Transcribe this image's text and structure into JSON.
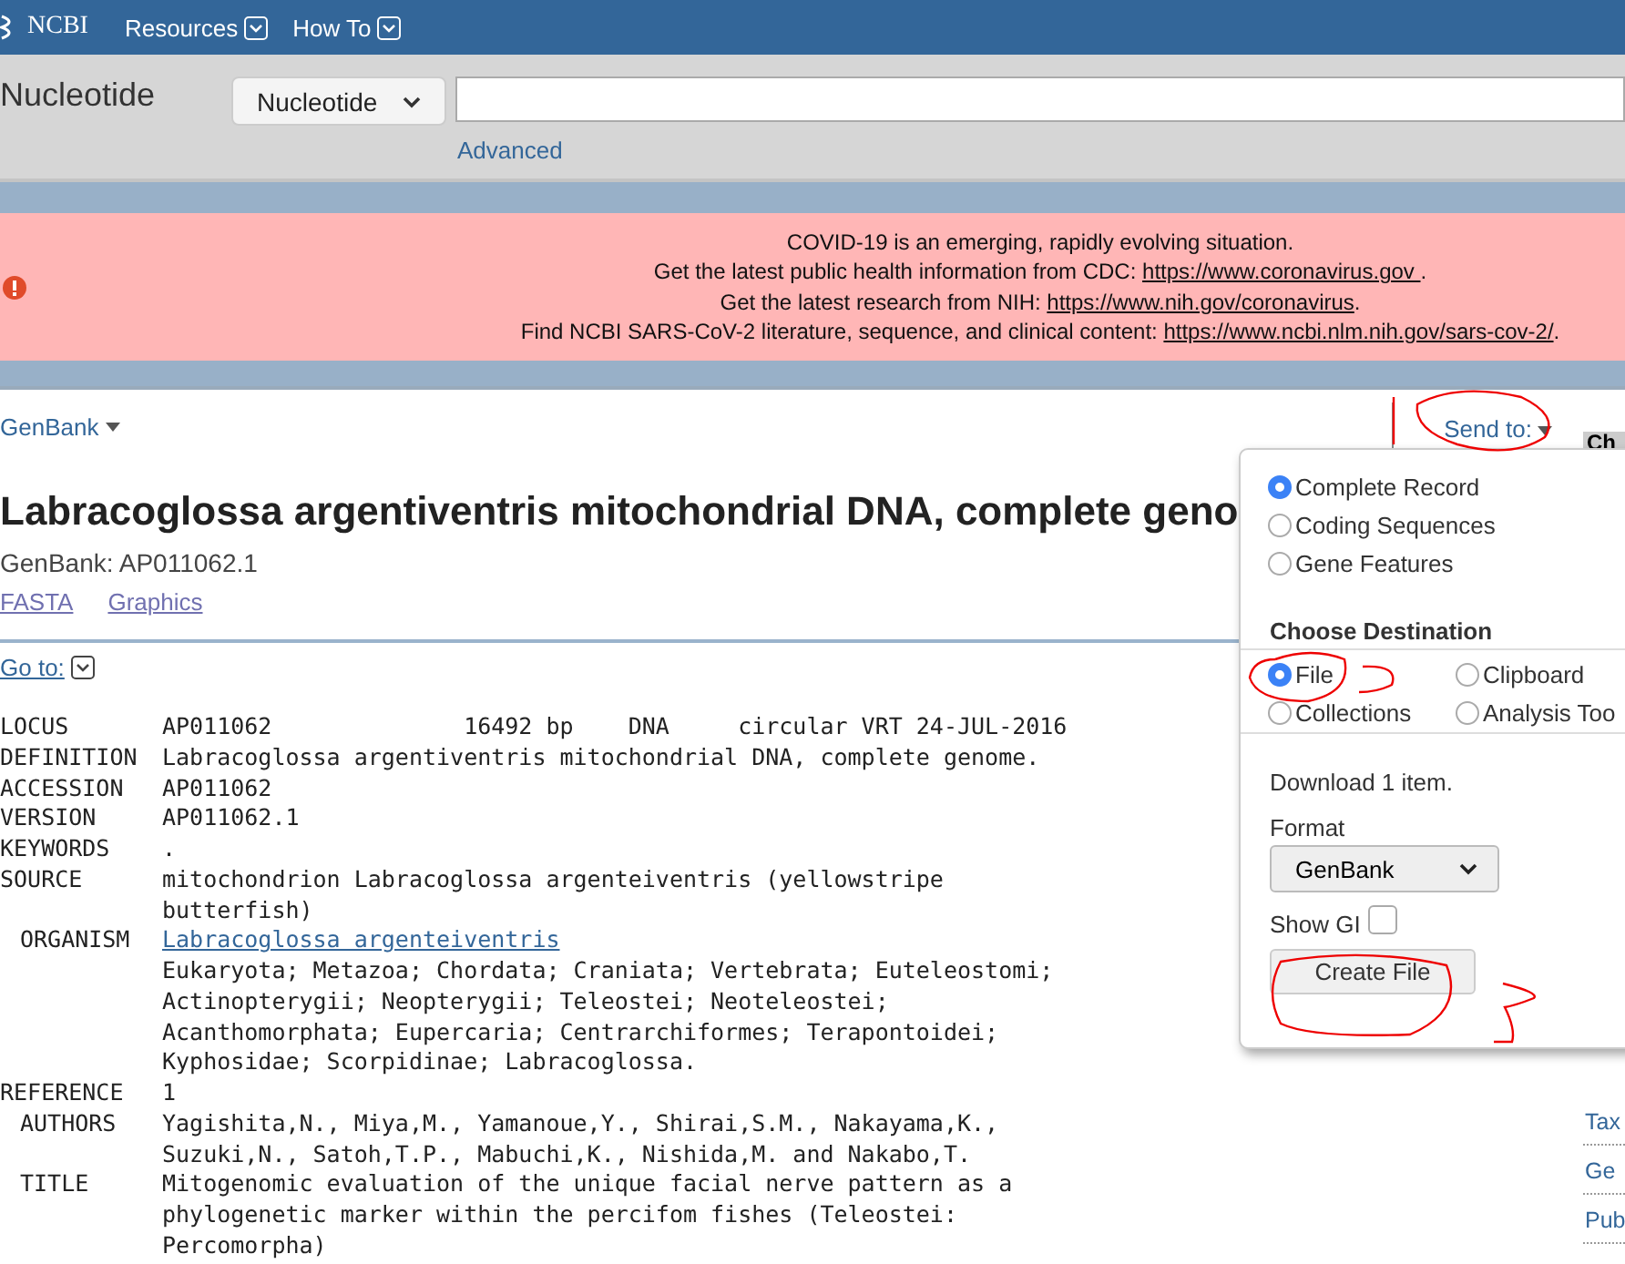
{
  "header": {
    "logo": "NCBI",
    "menus": [
      {
        "label": "Resources"
      },
      {
        "label": "How To"
      }
    ]
  },
  "search": {
    "database_title": "Nucleotide",
    "database_select": "Nucleotide",
    "advanced_link": "Advanced"
  },
  "alert": {
    "lines": [
      {
        "text": "COVID-19 is an emerging, rapidly evolving situation."
      },
      {
        "text": "Get the latest public health information from CDC: ",
        "link": "https://www.coronavirus.gov ",
        "after": "."
      },
      {
        "text": "Get the latest research from NIH: ",
        "link": "https://www.nih.gov/coronavirus",
        "after": "."
      },
      {
        "text": "Find NCBI SARS-CoV-2 literature, sequence, and clinical content: ",
        "link": "https://www.ncbi.nlm.nih.gov/sars-cov-2/",
        "after": "."
      }
    ]
  },
  "format_menu": "GenBank",
  "send_to": "Send to:",
  "side_button": "Ch",
  "record": {
    "title": "Labracoglossa argentiventris mitochondrial DNA, complete geno",
    "accession": "GenBank: AP011062.1",
    "links": [
      "FASTA",
      "Graphics"
    ],
    "goto": "Go to:",
    "fields": [
      {
        "label": "LOCUS",
        "lines": [
          "AP011062              16492 bp    DNA     circular VRT 24-JUL-2016"
        ]
      },
      {
        "label": "DEFINITION",
        "lines": [
          "Labracoglossa argentiventris mitochondrial DNA, complete genome."
        ]
      },
      {
        "label": "ACCESSION",
        "lines": [
          "AP011062"
        ]
      },
      {
        "label": "VERSION",
        "lines": [
          "AP011062.1"
        ]
      },
      {
        "label": "KEYWORDS",
        "lines": [
          "."
        ]
      },
      {
        "label": "SOURCE",
        "lines": [
          "mitochondrion Labracoglossa argenteiventris (yellowstripe",
          "butterfish)"
        ],
        "children": [
          {
            "label": "ORGANISM",
            "link": "Labracoglossa argenteiventris",
            "lines": [
              "Eukaryota; Metazoa; Chordata; Craniata; Vertebrata; Euteleostomi;",
              "Actinopterygii; Neopterygii; Teleostei; Neoteleostei;",
              "Acanthomorphata; Eupercaria; Centrarchiformes; Terapontoidei;",
              "Kyphosidae; Scorpidinae; Labracoglossa."
            ]
          }
        ]
      },
      {
        "label": "REFERENCE",
        "lines": [
          "1"
        ],
        "children": [
          {
            "label": "AUTHORS",
            "lines": [
              "Yagishita,N., Miya,M., Yamanoue,Y., Shirai,S.M., Nakayama,K.,",
              "Suzuki,N., Satoh,T.P., Mabuchi,K., Nishida,M. and Nakabo,T."
            ]
          },
          {
            "label": "TITLE",
            "lines": [
              "Mitogenomic evaluation of the unique facial nerve pattern as a",
              "phylogenetic marker within the percifom fishes (Teleostei:",
              "Percomorpha)"
            ]
          }
        ]
      }
    ]
  },
  "side_links": [
    "Tax",
    "Ge",
    "Pub"
  ],
  "send_panel": {
    "options": [
      {
        "label": "Complete Record",
        "selected": true
      },
      {
        "label": "Coding Sequences",
        "selected": false
      },
      {
        "label": "Gene Features",
        "selected": false
      }
    ],
    "destination_title": "Choose Destination",
    "destinations": [
      {
        "label": "File",
        "selected": true
      },
      {
        "label": "Clipboard",
        "selected": false
      },
      {
        "label": "Collections",
        "selected": false
      },
      {
        "label": "Analysis Too",
        "selected": false
      }
    ],
    "download_text": "Download 1 item.",
    "format_label": "Format",
    "format_value": "GenBank",
    "show_gi_label": "Show GI",
    "show_gi_checked": false,
    "create_button": "Create File"
  }
}
